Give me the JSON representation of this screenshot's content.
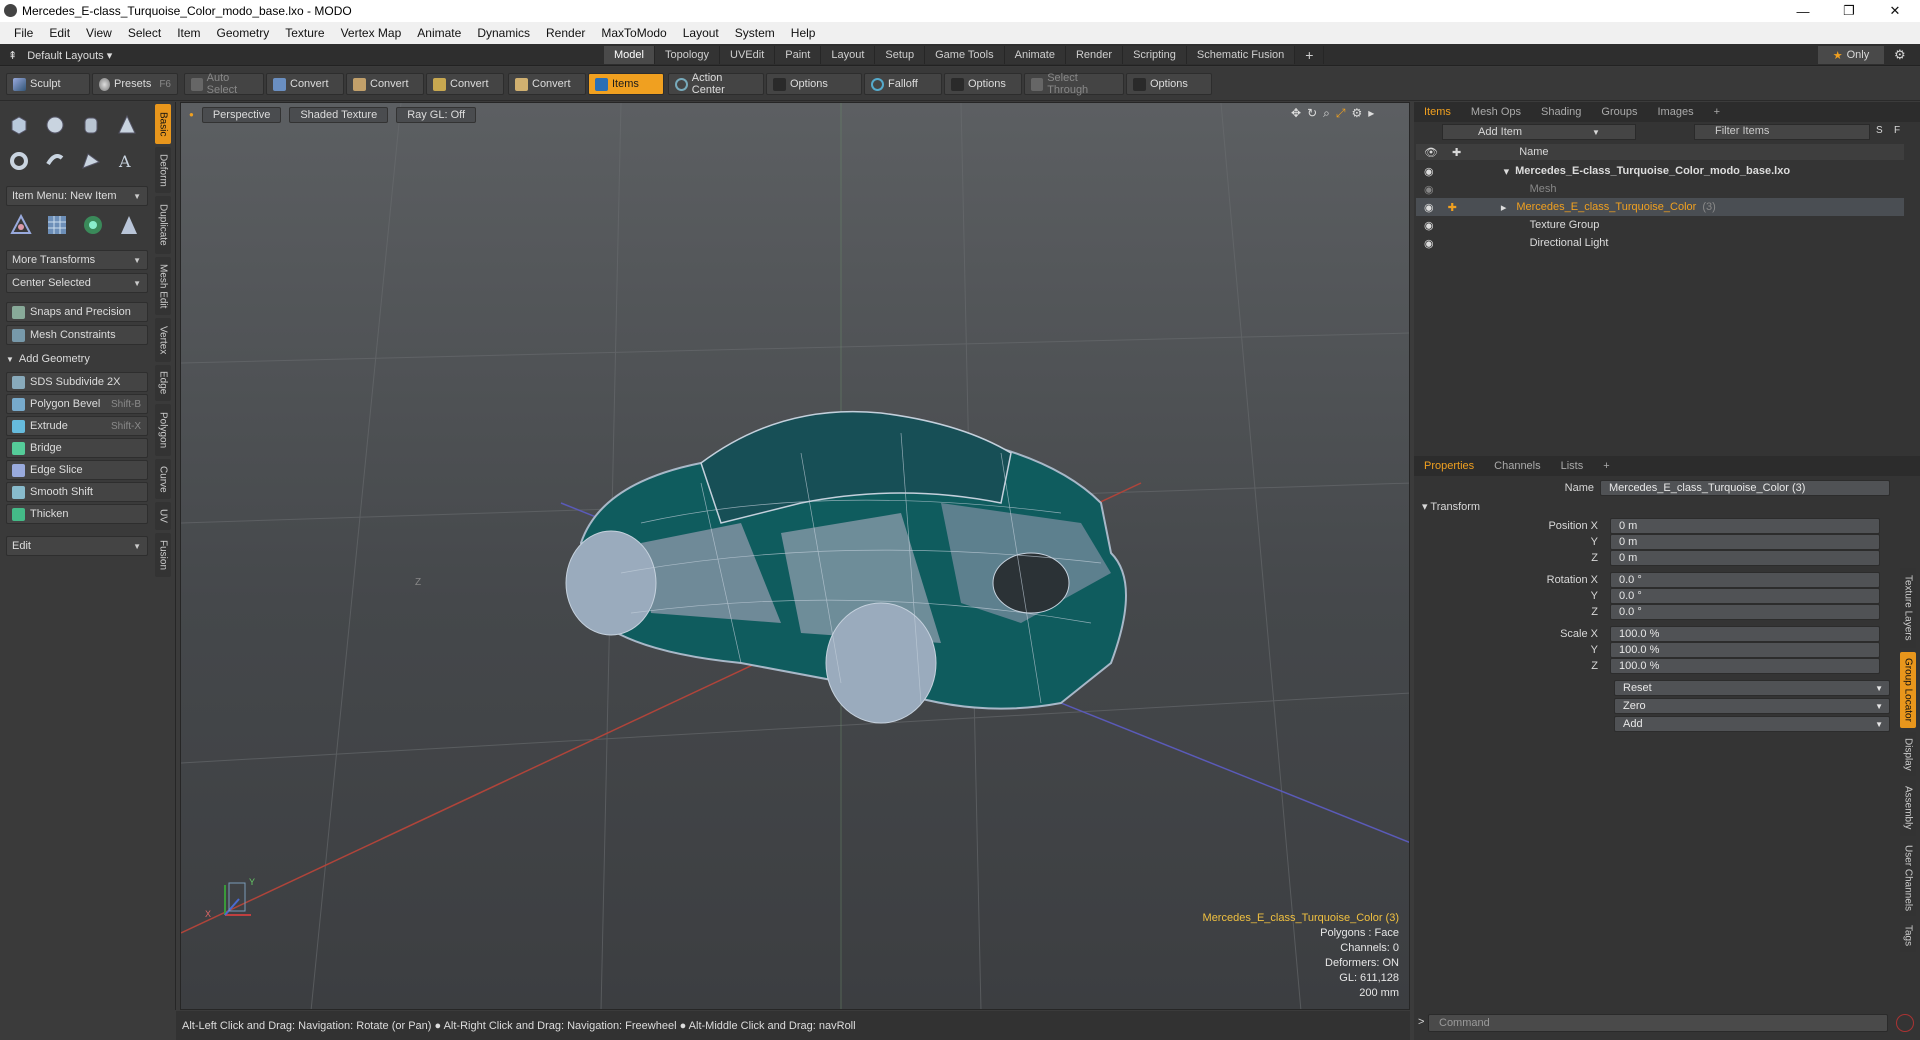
{
  "window": {
    "title": "Mercedes_E-class_Turquoise_Color_modo_base.lxo - MODO",
    "minimize": "—",
    "restore": "❐",
    "close": "✕"
  },
  "menu": [
    "File",
    "Edit",
    "View",
    "Select",
    "Item",
    "Geometry",
    "Texture",
    "Vertex Map",
    "Animate",
    "Dynamics",
    "Render",
    "MaxToModo",
    "Layout",
    "System",
    "Help"
  ],
  "layouts": {
    "label": "Default Layouts ▾"
  },
  "mode_tabs": [
    "Model",
    "Topology",
    "UVEdit",
    "Paint",
    "Layout",
    "Setup",
    "Game Tools",
    "Animate",
    "Render",
    "Scripting",
    "Schematic Fusion"
  ],
  "add_tab": "+",
  "only": {
    "label": "Only",
    "star": "★"
  },
  "toolbar": {
    "sculpt": "Sculpt",
    "presets": "Presets",
    "presets_sc": "F6",
    "auto_select": "Auto Select",
    "convert1": "Convert",
    "convert2": "Convert",
    "convert3": "Convert",
    "convert4": "Convert",
    "items": "Items",
    "action_center": "Action Center",
    "options1": "Options",
    "falloff": "Falloff",
    "options2": "Options",
    "select_through": "Select Through",
    "options3": "Options"
  },
  "left_vtabs": [
    "Basic",
    "Deform",
    "Duplicate",
    "Mesh Edit",
    "Vertex",
    "Edge",
    "Polygon",
    "Curve",
    "UV",
    "Fusion"
  ],
  "left": {
    "item_menu": "Item Menu: New Item",
    "more_transforms": "More Transforms",
    "center_selected": "Center Selected",
    "snaps": "Snaps and Precision",
    "mesh_constraints": "Mesh Constraints",
    "add_geometry": "Add Geometry",
    "sds": "SDS Subdivide 2X",
    "polygon_bevel": "Polygon Bevel",
    "polygon_bevel_sc": "Shift-B",
    "extrude": "Extrude",
    "extrude_sc": "Shift-X",
    "bridge": "Bridge",
    "edge_slice": "Edge Slice",
    "smooth_shift": "Smooth Shift",
    "thicken": "Thicken",
    "edit": "Edit"
  },
  "viewport": {
    "perspective": "Perspective",
    "shaded": "Shaded Texture",
    "raygl": "Ray GL: Off",
    "info_name": "Mercedes_E_class_Turquoise_Color (3)",
    "polygons": "Polygons : Face",
    "channels": "Channels: 0",
    "deformers": "Deformers: ON",
    "gl": "GL: 611,128",
    "scale": "200 mm",
    "axis_y": "Y",
    "axis_x": "X",
    "axis_z": "Z"
  },
  "status": "Alt-Left Click and Drag: Navigation: Rotate (or Pan) ● Alt-Right Click and Drag: Navigation: Freewheel ● Alt-Middle Click and Drag: navRoll",
  "items_panel": {
    "tabs": [
      "Items",
      "Mesh Ops",
      "Shading",
      "Groups",
      "Images"
    ],
    "add_item": "Add Item",
    "filter": "Filter Items",
    "name_col": "Name",
    "s": "S",
    "f": "F",
    "rows": [
      {
        "label": "Mercedes_E-class_Turquoise_Color_modo_base.lxo",
        "indent": 0
      },
      {
        "label": "Mesh",
        "indent": 1
      },
      {
        "label": "Mercedes_E_class_Turquoise_Color",
        "suffix": "(3)",
        "indent": 1
      },
      {
        "label": "Texture Group",
        "indent": 1
      },
      {
        "label": "Directional Light",
        "indent": 1
      }
    ]
  },
  "props_panel": {
    "tabs": [
      "Properties",
      "Channels",
      "Lists"
    ],
    "name_label": "Name",
    "name_value": "Mercedes_E_class_Turquoise_Color (3)",
    "transform": "Transform",
    "position_label": "Position X",
    "rotation_label": "Rotation X",
    "scale_label": "Scale X",
    "y": "Y",
    "z": "Z",
    "pos": [
      "0 m",
      "0 m",
      "0 m"
    ],
    "rot": [
      "0.0 °",
      "0.0 °",
      "0.0 °"
    ],
    "scl": [
      "100.0 %",
      "100.0 %",
      "100.0 %"
    ],
    "reset": "Reset",
    "zero": "Zero",
    "add": "Add"
  },
  "right_vtabs": [
    "Texture Layers",
    "Group Locator",
    "Display",
    "Assembly",
    "User Channels",
    "Tags"
  ],
  "command": {
    "placeholder": "Command"
  }
}
